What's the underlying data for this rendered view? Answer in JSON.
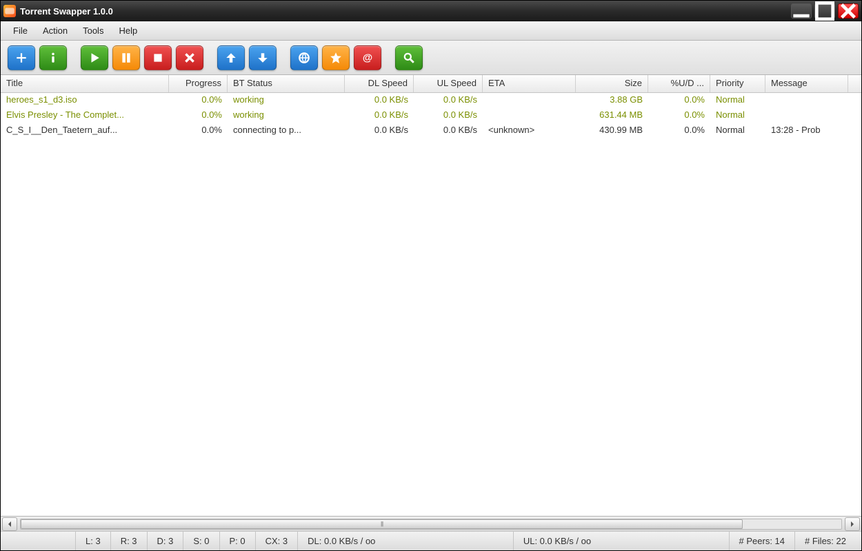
{
  "window": {
    "title": "Torrent Swapper 1.0.0"
  },
  "menu": {
    "file": "File",
    "action": "Action",
    "tools": "Tools",
    "help": "Help"
  },
  "columns": {
    "title": "Title",
    "progress": "Progress",
    "status": "BT Status",
    "dl": "DL Speed",
    "ul": "UL Speed",
    "eta": "ETA",
    "size": "Size",
    "ud": "%U/D ...",
    "priority": "Priority",
    "message": "Message"
  },
  "rows": [
    {
      "title": "heroes_s1_d3.iso",
      "progress": "0.0%",
      "status": "working",
      "dl": "0.0 KB/s",
      "ul": "0.0 KB/s",
      "eta": "",
      "size": "3.88 GB",
      "ud": "0.0%",
      "priority": "Normal",
      "message": "",
      "active": true
    },
    {
      "title": "Elvis Presley - The Complet...",
      "progress": "0.0%",
      "status": "working",
      "dl": "0.0 KB/s",
      "ul": "0.0 KB/s",
      "eta": "",
      "size": "631.44 MB",
      "ud": "0.0%",
      "priority": "Normal",
      "message": "",
      "active": true
    },
    {
      "title": "C_S_I__Den_Taetern_auf...",
      "progress": "0.0%",
      "status": "connecting to p...",
      "dl": "0.0 KB/s",
      "ul": "0.0 KB/s",
      "eta": "<unknown>",
      "size": "430.99 MB",
      "ud": "0.0%",
      "priority": "Normal",
      "message": "13:28 - Prob",
      "active": false
    }
  ],
  "status": {
    "l": "L: 3",
    "r": "R: 3",
    "d": "D: 3",
    "s": "S: 0",
    "p": "P: 0",
    "cx": "CX: 3",
    "dl": "DL: 0.0 KB/s / oo",
    "ul": "UL: 0.0 KB/s / oo",
    "peers": "# Peers: 14",
    "files": "# Files: 22"
  }
}
